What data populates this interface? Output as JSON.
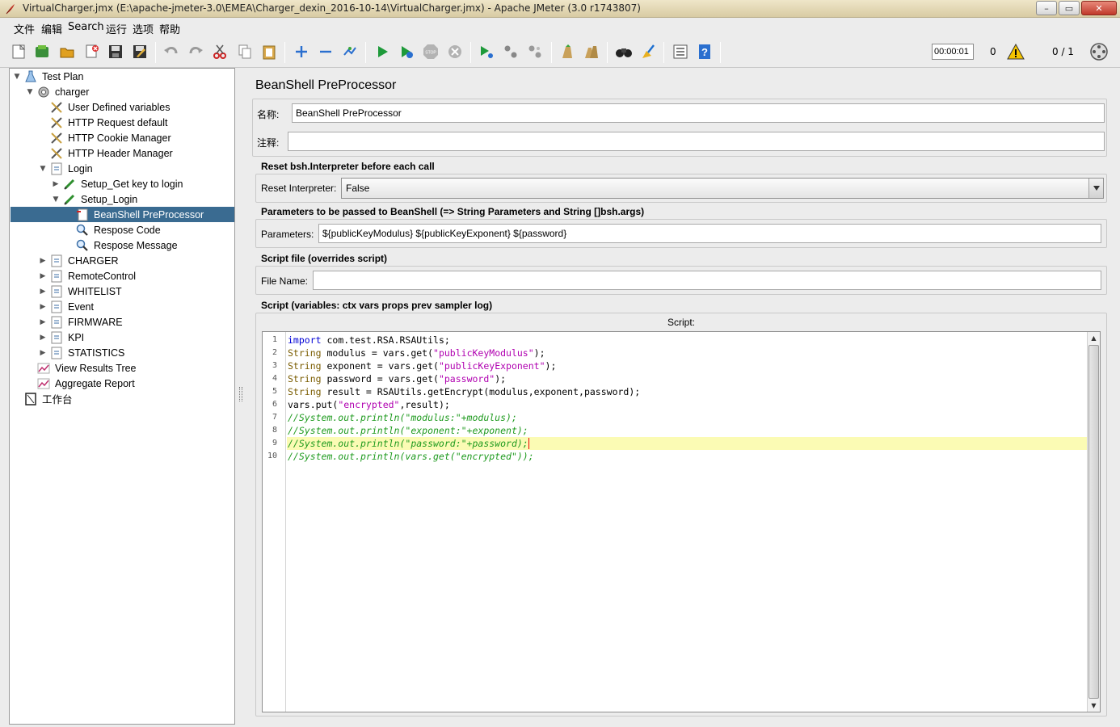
{
  "window": {
    "title": "VirtualCharger.jmx (E:\\apache-jmeter-3.0\\EMEA\\Charger_dexin_2016-10-14\\VirtualCharger.jmx) - Apache JMeter (3.0 r1743807)",
    "minimize": "–",
    "maximize": "▭",
    "close": "✕"
  },
  "menu": [
    "文件",
    "编辑",
    "Search",
    "运行",
    "选项",
    "帮助"
  ],
  "toolbar": {
    "timer": "00:00:01",
    "active_threads": "0",
    "thread_ratio": "0 / 1",
    "icons": [
      "new-icon",
      "templates-icon",
      "open-icon",
      "close-icon",
      "save-icon",
      "save-as-icon",
      "undo-icon",
      "redo-icon",
      "cut-icon",
      "copy-icon",
      "paste-icon",
      "expand-icon",
      "collapse-icon",
      "toggle-icon",
      "start-icon",
      "start-no-pauses-icon",
      "stop-icon",
      "shutdown-icon",
      "remote-start-icon",
      "remote-stop-icon",
      "remote-shutdown-icon",
      "clear-icon",
      "clear-all-icon",
      "search-icon",
      "reset-search-icon",
      "function-helper-icon",
      "help-icon"
    ]
  },
  "tree": [
    {
      "label": "Test Plan",
      "toggle": "▼",
      "icon": "test-plan-icon"
    },
    {
      "label": "charger",
      "toggle": "▼",
      "icon": "thread-group-icon"
    },
    {
      "label": "User Defined variables",
      "toggle": "",
      "icon": "config-icon"
    },
    {
      "label": "HTTP Request  default",
      "toggle": "",
      "icon": "config-icon"
    },
    {
      "label": "HTTP Cookie Manager",
      "toggle": "",
      "icon": "config-icon"
    },
    {
      "label": "HTTP Header Manager",
      "toggle": "",
      "icon": "config-icon"
    },
    {
      "label": "Login",
      "toggle": "▼",
      "icon": "controller-icon"
    },
    {
      "label": "Setup_Get key to login",
      "toggle": "▶",
      "icon": "sampler-icon"
    },
    {
      "label": "Setup_Login",
      "toggle": "▼",
      "icon": "sampler-icon"
    },
    {
      "label": "BeanShell PreProcessor",
      "toggle": "",
      "icon": "preprocessor-icon"
    },
    {
      "label": "Respose Code",
      "toggle": "",
      "icon": "assertion-icon"
    },
    {
      "label": "Respose Message",
      "toggle": "",
      "icon": "assertion-icon"
    },
    {
      "label": "CHARGER",
      "toggle": "▶",
      "icon": "controller-icon"
    },
    {
      "label": "RemoteControl",
      "toggle": "▶",
      "icon": "controller-icon"
    },
    {
      "label": "WHITELIST",
      "toggle": "▶",
      "icon": "controller-icon"
    },
    {
      "label": "Event",
      "toggle": "▶",
      "icon": "controller-icon"
    },
    {
      "label": "FIRMWARE",
      "toggle": "▶",
      "icon": "controller-icon"
    },
    {
      "label": "KPI",
      "toggle": "▶",
      "icon": "controller-icon"
    },
    {
      "label": "STATISTICS",
      "toggle": "▶",
      "icon": "controller-icon"
    },
    {
      "label": "View Results Tree",
      "toggle": "",
      "icon": "listener-icon"
    },
    {
      "label": "Aggregate Report",
      "toggle": "",
      "icon": "listener-icon"
    },
    {
      "label": "工作台",
      "toggle": "",
      "icon": "workbench-icon"
    }
  ],
  "panel": {
    "title": "BeanShell PreProcessor",
    "name_label": "名称:",
    "name_value": "BeanShell PreProcessor",
    "comment_label": "注释:",
    "comment_value": "",
    "reset_section": "Reset bsh.Interpreter before each call",
    "reset_label": "Reset Interpreter:",
    "reset_value": "False",
    "params_section": "Parameters to be passed to BeanShell (=> String Parameters and String []bsh.args)",
    "params_label": "Parameters:",
    "params_value": "${publicKeyModulus} ${publicKeyExponent} ${password}",
    "script_file_section": "Script file (overrides script)",
    "file_label": "File Name:",
    "file_value": "",
    "script_section": "Script (variables: ctx vars props prev sampler log)",
    "script_label": "Script:"
  },
  "script": {
    "highlighted_line": 9,
    "lines": [
      "import com.test.RSA.RSAUtils;",
      "String modulus = vars.get(\"publicKeyModulus\");",
      "String exponent = vars.get(\"publicKeyExponent\");",
      "String password = vars.get(\"password\");",
      "String result = RSAUtils.getEncrypt(modulus,exponent,password);",
      "vars.put(\"encrypted\",result);",
      "//System.out.println(\"modulus:\"+modulus);",
      "//System.out.println(\"exponent:\"+exponent);",
      "//System.out.println(\"password:\"+password);",
      "//System.out.println(vars.get(\"encrypted\"));"
    ]
  }
}
